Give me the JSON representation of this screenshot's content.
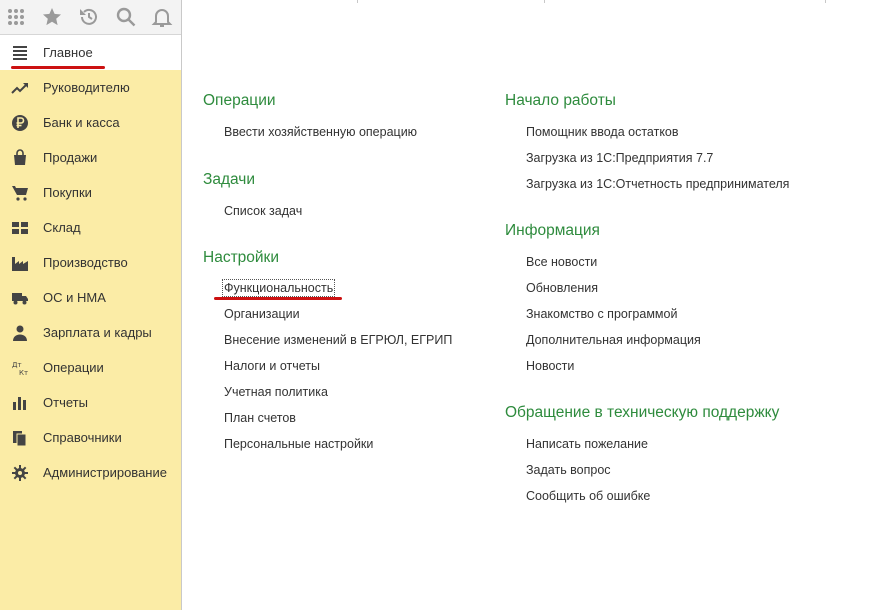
{
  "sidebar": {
    "toolbar_icons": [
      "apps-grid-icon",
      "star-icon",
      "history-icon",
      "search-icon",
      "bell-icon"
    ],
    "items": [
      {
        "label": "Главное",
        "icon": "menu-lines-icon",
        "active": true
      },
      {
        "label": "Руководителю",
        "icon": "trend-icon"
      },
      {
        "label": "Банк и касса",
        "icon": "ruble-icon"
      },
      {
        "label": "Продажи",
        "icon": "bag-icon"
      },
      {
        "label": "Покупки",
        "icon": "cart-icon"
      },
      {
        "label": "Склад",
        "icon": "warehouse-icon"
      },
      {
        "label": "Производство",
        "icon": "factory-icon"
      },
      {
        "label": "ОС и НМА",
        "icon": "truck-icon"
      },
      {
        "label": "Зарплата и кадры",
        "icon": "person-icon"
      },
      {
        "label": "Операции",
        "icon": "dt-kt-icon"
      },
      {
        "label": "Отчеты",
        "icon": "bar-chart-icon"
      },
      {
        "label": "Справочники",
        "icon": "books-icon"
      },
      {
        "label": "Администрирование",
        "icon": "gear-icon"
      }
    ]
  },
  "content": {
    "left": {
      "operations": {
        "title": "Операции",
        "links": [
          "Ввести хозяйственную операцию"
        ]
      },
      "tasks": {
        "title": "Задачи",
        "links": [
          "Список задач"
        ]
      },
      "settings": {
        "title": "Настройки",
        "links": [
          "Функциональность",
          "Организации",
          "Внесение изменений в ЕГРЮЛ, ЕГРИП",
          "Налоги и отчеты",
          "Учетная политика",
          "План счетов",
          "Персональные настройки"
        ]
      }
    },
    "right": {
      "start": {
        "title": "Начало работы",
        "links": [
          "Помощник ввода остатков",
          "Загрузка из 1С:Предприятия 7.7",
          "Загрузка из 1С:Отчетность предпринимателя"
        ]
      },
      "info": {
        "title": "Информация",
        "links": [
          "Все новости",
          "Обновления",
          "Знакомство с программой",
          "Дополнительная информация",
          "Новости"
        ]
      },
      "support": {
        "title": "Обращение в техническую поддержку",
        "links": [
          "Написать пожелание",
          "Задать вопрос",
          "Сообщить об ошибке"
        ]
      }
    }
  },
  "colors": {
    "sidebar_bg": "#fbeca6",
    "section_title": "#2e8b3d",
    "highlight_underline": "#cc1111"
  }
}
